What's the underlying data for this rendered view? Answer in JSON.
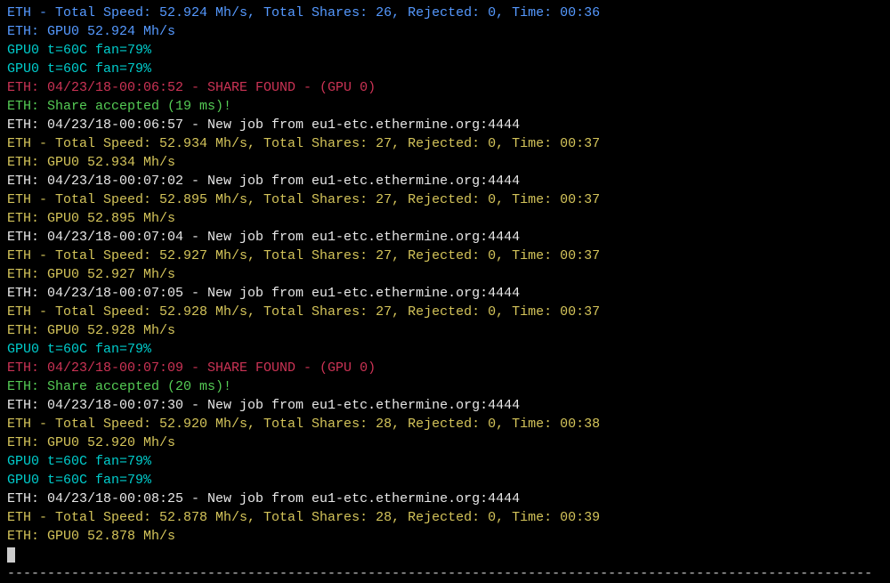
{
  "lines": [
    {
      "class": "c-blue",
      "text": "ETH - Total Speed: 52.924 Mh/s, Total Shares: 26, Rejected: 0, Time: 00:36"
    },
    {
      "class": "c-blue",
      "text": "ETH: GPU0 52.924 Mh/s"
    },
    {
      "class": "c-cyan",
      "text": "GPU0 t=60C fan=79%"
    },
    {
      "class": "c-cyan",
      "text": "GPU0 t=60C fan=79%"
    },
    {
      "class": "c-red",
      "text": "ETH: 04/23/18-00:06:52 - SHARE FOUND - (GPU 0)"
    },
    {
      "class": "c-green",
      "text": "ETH: Share accepted (19 ms)!"
    },
    {
      "class": "c-white",
      "text": "ETH: 04/23/18-00:06:57 - New job from eu1-etc.ethermine.org:4444"
    },
    {
      "class": "c-yellow",
      "text": "ETH - Total Speed: 52.934 Mh/s, Total Shares: 27, Rejected: 0, Time: 00:37"
    },
    {
      "class": "c-yellow",
      "text": "ETH: GPU0 52.934 Mh/s"
    },
    {
      "class": "c-white",
      "text": "ETH: 04/23/18-00:07:02 - New job from eu1-etc.ethermine.org:4444"
    },
    {
      "class": "c-yellow",
      "text": "ETH - Total Speed: 52.895 Mh/s, Total Shares: 27, Rejected: 0, Time: 00:37"
    },
    {
      "class": "c-yellow",
      "text": "ETH: GPU0 52.895 Mh/s"
    },
    {
      "class": "c-white",
      "text": "ETH: 04/23/18-00:07:04 - New job from eu1-etc.ethermine.org:4444"
    },
    {
      "class": "c-yellow",
      "text": "ETH - Total Speed: 52.927 Mh/s, Total Shares: 27, Rejected: 0, Time: 00:37"
    },
    {
      "class": "c-yellow",
      "text": "ETH: GPU0 52.927 Mh/s"
    },
    {
      "class": "c-white",
      "text": "ETH: 04/23/18-00:07:05 - New job from eu1-etc.ethermine.org:4444"
    },
    {
      "class": "c-yellow",
      "text": "ETH - Total Speed: 52.928 Mh/s, Total Shares: 27, Rejected: 0, Time: 00:37"
    },
    {
      "class": "c-yellow",
      "text": "ETH: GPU0 52.928 Mh/s"
    },
    {
      "class": "c-cyan",
      "text": "GPU0 t=60C fan=79%"
    },
    {
      "class": "c-red",
      "text": "ETH: 04/23/18-00:07:09 - SHARE FOUND - (GPU 0)"
    },
    {
      "class": "c-green",
      "text": "ETH: Share accepted (20 ms)!"
    },
    {
      "class": "c-white",
      "text": "ETH: 04/23/18-00:07:30 - New job from eu1-etc.ethermine.org:4444"
    },
    {
      "class": "c-yellow",
      "text": "ETH - Total Speed: 52.920 Mh/s, Total Shares: 28, Rejected: 0, Time: 00:38"
    },
    {
      "class": "c-yellow",
      "text": "ETH: GPU0 52.920 Mh/s"
    },
    {
      "class": "c-cyan",
      "text": "GPU0 t=60C fan=79%"
    },
    {
      "class": "c-cyan",
      "text": "GPU0 t=60C fan=79%"
    },
    {
      "class": "c-white",
      "text": "ETH: 04/23/18-00:08:25 - New job from eu1-etc.ethermine.org:4444"
    },
    {
      "class": "c-yellow",
      "text": "ETH - Total Speed: 52.878 Mh/s, Total Shares: 28, Rejected: 0, Time: 00:39"
    },
    {
      "class": "c-yellow",
      "text": "ETH: GPU0 52.878 Mh/s"
    }
  ],
  "separator": "------------------------------------------------------------------------------------------------------------"
}
